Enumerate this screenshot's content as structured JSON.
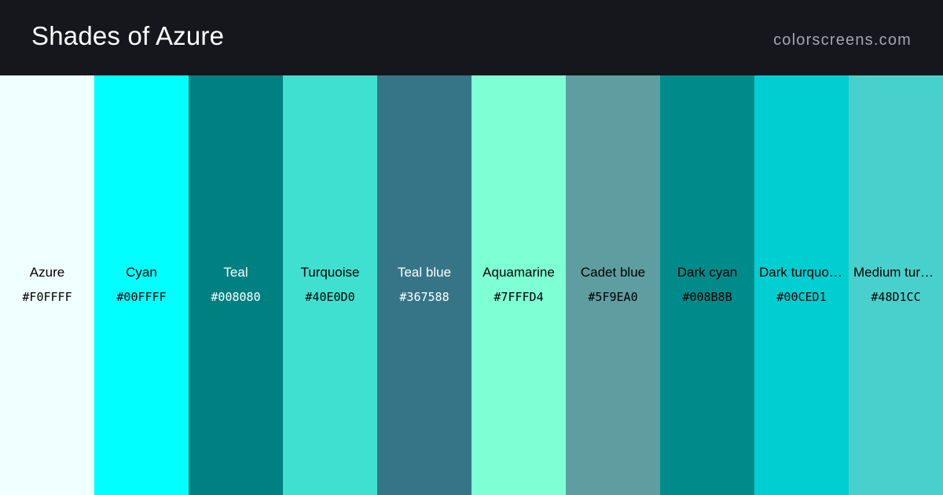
{
  "header": {
    "title": "Shades of Azure",
    "site": "colorscreens.com"
  },
  "swatches": [
    {
      "name": "Azure",
      "hex": "#F0FFFF",
      "color": "#F0FFFF",
      "text_color": "#000000"
    },
    {
      "name": "Cyan",
      "hex": "#00FFFF",
      "color": "#00FFFF",
      "text_color": "#000000"
    },
    {
      "name": "Teal",
      "hex": "#008080",
      "color": "#008080",
      "text_color": "#FFFFFF"
    },
    {
      "name": "Turquoise",
      "hex": "#40E0D0",
      "color": "#40E0D0",
      "text_color": "#000000"
    },
    {
      "name": "Teal blue",
      "hex": "#367588",
      "color": "#367588",
      "text_color": "#FFFFFF"
    },
    {
      "name": "Aquamarine",
      "hex": "#7FFFD4",
      "color": "#7FFFD4",
      "text_color": "#000000"
    },
    {
      "name": "Cadet blue",
      "hex": "#5F9EA0",
      "color": "#5F9EA0",
      "text_color": "#000000"
    },
    {
      "name": "Dark cyan",
      "hex": "#008B8B",
      "color": "#008B8B",
      "text_color": "#000000"
    },
    {
      "name": "Dark turquoise",
      "hex": "#00CED1",
      "color": "#00CED1",
      "text_color": "#000000"
    },
    {
      "name": "Medium turquoise",
      "hex": "#48D1CC",
      "color": "#48D1CC",
      "text_color": "#000000"
    }
  ]
}
